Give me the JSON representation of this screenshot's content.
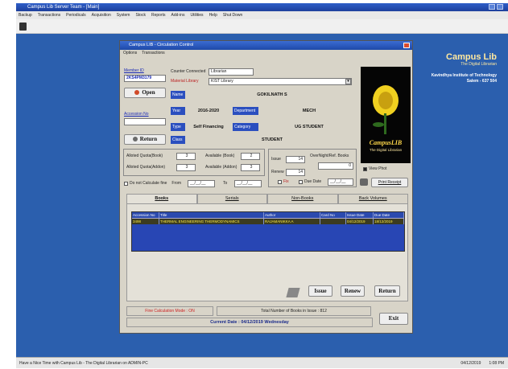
{
  "window": {
    "title": "Campus Lib Server Team - [Main]"
  },
  "menu": [
    "Backup",
    "Transactions",
    "Periodicals",
    "Acquisition",
    "System",
    "Stock",
    "Reports",
    "Add-ins",
    "Utilities",
    "Help",
    "Shut Down"
  ],
  "logo": {
    "title": "Campus Lib",
    "subtitle": "The Digital Librarian",
    "institute": "Kavindhya Institute of Technology",
    "location": "Salem - 637 504"
  },
  "dialog": {
    "title": "Campus LIB - Circulation Control",
    "menu": [
      "Options",
      "Transactions"
    ],
    "member_id_label": "Member ID",
    "member_id_value": "2KS4PM3179",
    "counter_label": "Counter Connected",
    "counter_value": "Librarian",
    "material_label": "Material Library",
    "material_value": "KIST Library",
    "open_label": "Open",
    "name_tag": "Name",
    "name_value": "GOKILNATH S",
    "accession_label": "Accession No",
    "year_tag": "Year",
    "year_value": "2016-2020",
    "dept_tag": "Department",
    "dept_value": "MECH",
    "type_tag": "Type",
    "type_value": "Self Financing",
    "category_tag": "Category",
    "category_value": "UG STUDENT",
    "class_tag": "Class",
    "class_value": "STUDENT",
    "return_label": "Return",
    "allotted_book_label": "Alloted Quota(Book)",
    "allotted_book_value": "3",
    "available_book_label": "Available (Book)",
    "available_book_value": "2",
    "allotted_addon_label": "Alloted Quota(Addon)",
    "allotted_addon_value": "3",
    "available_addon_label": "Available (Addon)",
    "available_addon_value": "3",
    "issue_label": "Issue",
    "issue_value": "14",
    "overnight_label": "OverNight/Ref. Books",
    "overnight_value": "0",
    "renew_label": "Renew",
    "renew_value": "14",
    "fix_label": "Fix",
    "due_date_label": "Due Date",
    "due_date_value": "__/__/__",
    "no_calc_label": "Do not Calculate fine",
    "from_label": "From",
    "from_value": "__/__/__",
    "to_label": "To",
    "to_value": "__/__/__",
    "photo_caption": "CampusLIB",
    "photo_sub": "The Digital Librarian",
    "view_photo_label": "View Phot",
    "print_receipt_label": "Print Receipt",
    "tabs": [
      "Books",
      "Serials",
      "Non-Books",
      "Back Volumes"
    ],
    "grid_columns": [
      "Accession No",
      "Title",
      "Author",
      "Card No",
      "Issue Date",
      "Due Date"
    ],
    "grid_rows": [
      [
        "3498",
        "THERMAL ENGINEERING THERMODYNAMICS",
        "RAJAMANIKKA A",
        "",
        "04/12/2019",
        "18/12/2019"
      ]
    ],
    "issue_btn": "Issue",
    "renew_btn": "Renew",
    "return_btn": "Return",
    "fine_mode": "Fine Calculation Mode : ON",
    "total_books": "Total Number of Books in Issue : 812",
    "exit_btn": "Exit",
    "current_date": "Current Date : 04/12/2019 Wednesday"
  },
  "status": {
    "left": "Have a Nice Time with Campus Lib - The Digital Librarian on ADMIN-PC",
    "date": "04/12/2019",
    "time": "1:08 PM"
  },
  "colors": {
    "desktop": "#2b5fae",
    "titlebar": "#1d3f9c",
    "tag": "#2b4fbf",
    "grid_row_text": "#ffee44"
  }
}
